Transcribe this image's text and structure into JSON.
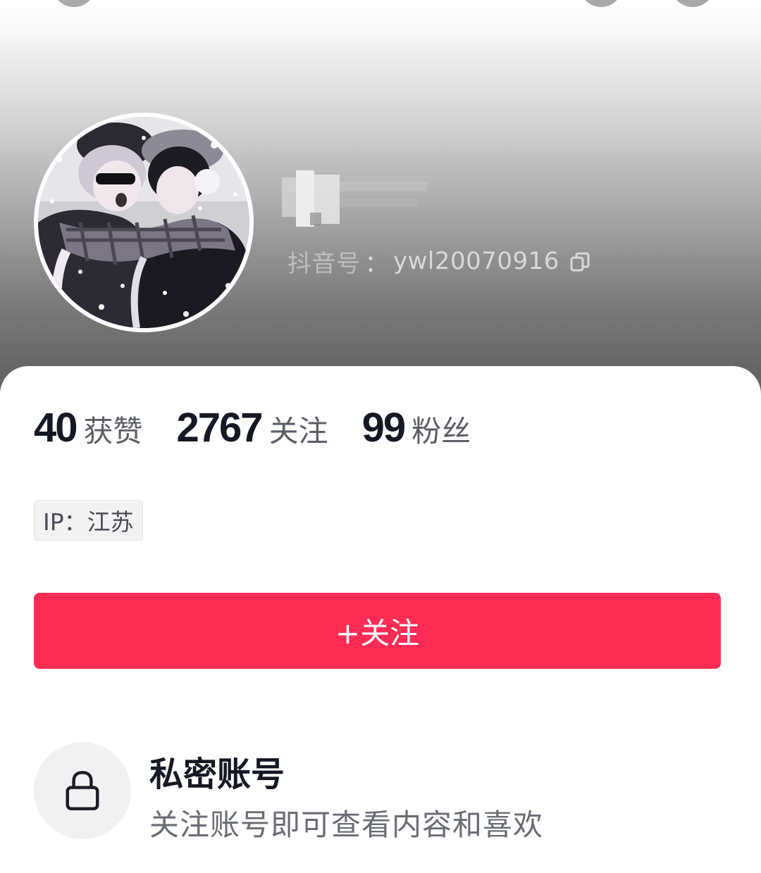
{
  "profile": {
    "account_id_label": "抖音号",
    "account_id_separator": "：",
    "account_id": "ywl20070916"
  },
  "stats": [
    {
      "value": "40",
      "label": "获赞"
    },
    {
      "value": "2767",
      "label": "关注"
    },
    {
      "value": "99",
      "label": "粉丝"
    }
  ],
  "ip_tag": "IP：江苏",
  "follow_button": "+关注",
  "private": {
    "title": "私密账号",
    "description": "关注账号即可查看内容和喜欢"
  },
  "icons": {
    "copy": "copy-icon",
    "lock": "lock-icon"
  },
  "colors": {
    "accent": "#fe2c55",
    "text_primary": "#161823",
    "text_secondary": "#5c5e66"
  }
}
